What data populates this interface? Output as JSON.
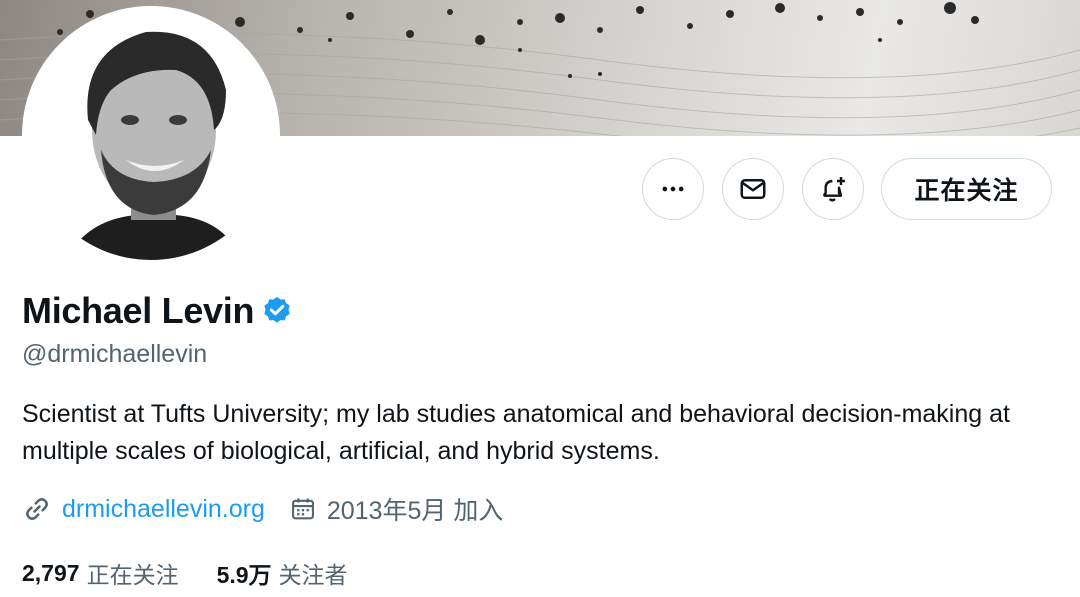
{
  "profile": {
    "name": "Michael Levin",
    "handle": "@drmichaellevin",
    "bio": "Scientist at Tufts University; my lab studies anatomical and behavioral decision-making at multiple scales of biological, artificial, and hybrid systems.",
    "website": "drmichaellevin.org",
    "joined": "2013年5月 加入",
    "verified_color": "#1d9bf0"
  },
  "actions": {
    "more_icon": "more-horizontal-icon",
    "message_icon": "envelope-icon",
    "notify_icon": "bell-plus-icon",
    "follow_label": "正在关注"
  },
  "stats": {
    "following_count": "2,797",
    "following_label": "正在关注",
    "followers_count": "5.9万",
    "followers_label": "关注者"
  },
  "colors": {
    "accent": "#1d9bf0",
    "secondary_text": "#536471",
    "border": "#cfd9de"
  }
}
